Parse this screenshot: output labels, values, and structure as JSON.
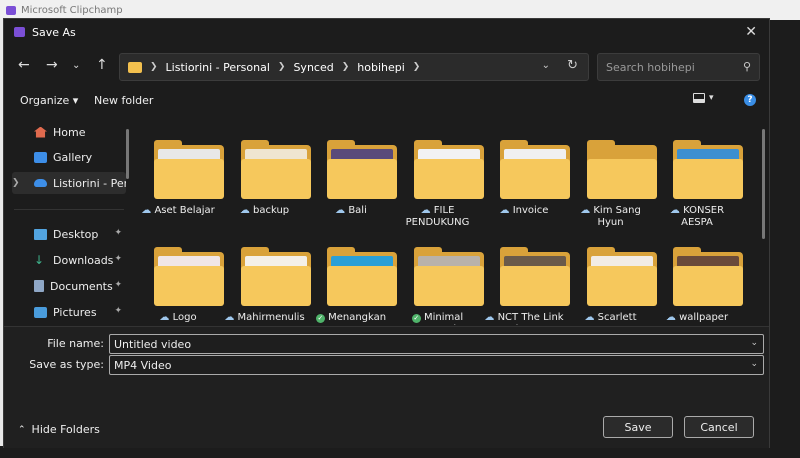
{
  "app": {
    "title": "Microsoft Clipchamp",
    "accent": "#7b4fd6"
  },
  "dialog": {
    "title": "Save As",
    "close_icon": "close-icon"
  },
  "address": {
    "crumbs": [
      "Listiorini - Personal",
      "Synced",
      "hobihepi"
    ]
  },
  "search": {
    "placeholder": "Search hobihepi"
  },
  "toolbar": {
    "organize": "Organize",
    "new_folder": "New folder",
    "help": "?"
  },
  "sidebar": {
    "items": [
      {
        "label": "Home",
        "icon": "home-icon",
        "color": "#e06a4e"
      },
      {
        "label": "Gallery",
        "icon": "gallery-icon",
        "color": "#3d8ee8"
      },
      {
        "label": "Listiorini - Personal",
        "icon": "cloud-icon",
        "color": "#3d8ee8",
        "selected": true
      },
      {
        "label": "Desktop",
        "icon": "desktop-icon",
        "color": "#52a4e0",
        "pinned": true
      },
      {
        "label": "Downloads",
        "icon": "download-icon",
        "color": "#3fb38c",
        "pinned": true
      },
      {
        "label": "Documents",
        "icon": "documents-icon",
        "color": "#8fa7c6",
        "pinned": true
      },
      {
        "label": "Pictures",
        "icon": "pictures-icon",
        "color": "#4a9cdc",
        "pinned": true
      }
    ]
  },
  "folders": [
    {
      "name": "Aset Belajar",
      "status": "cloud",
      "thumb": "#e8e8e8"
    },
    {
      "name": "backup",
      "status": "cloud",
      "thumb": "#efe5d0"
    },
    {
      "name": "Bali",
      "status": "cloud",
      "thumb": "#5a4a7a"
    },
    {
      "name": "FILE PENDUKUNG",
      "status": "cloud",
      "thumb": "#f2f2f2"
    },
    {
      "name": "Invoice",
      "status": "cloud",
      "thumb": "#f0f0f0"
    },
    {
      "name": "Kim Sang Hyun",
      "status": "cloud",
      "thumb": ""
    },
    {
      "name": "KONSER AESPA",
      "status": "cloud",
      "thumb": "#3c8fd0"
    },
    {
      "name": "Logo",
      "status": "cloud",
      "thumb": "#f0e6e6"
    },
    {
      "name": "Mahirmenulis",
      "status": "cloud",
      "thumb": "#f4f0e8"
    },
    {
      "name": "Menangkan Game Steam",
      "status": "synced",
      "thumb": "#2a9fd6"
    },
    {
      "name": "Minimal Coastal",
      "status": "synced",
      "thumb": "#b9b2aa"
    },
    {
      "name": "NCT The Link Jakarta",
      "status": "cloud",
      "thumb": "#6a5a4a"
    },
    {
      "name": "Scarlett",
      "status": "cloud",
      "thumb": "#f2ece4"
    },
    {
      "name": "wallpaper",
      "status": "cloud",
      "thumb": "#6a4a3a"
    }
  ],
  "form": {
    "file_name_label": "File name:",
    "file_name_value": "Untitled video",
    "save_type_label": "Save as type:",
    "save_type_value": "MP4 Video"
  },
  "footer": {
    "hide_folders": "Hide Folders",
    "save": "Save",
    "cancel": "Cancel"
  }
}
